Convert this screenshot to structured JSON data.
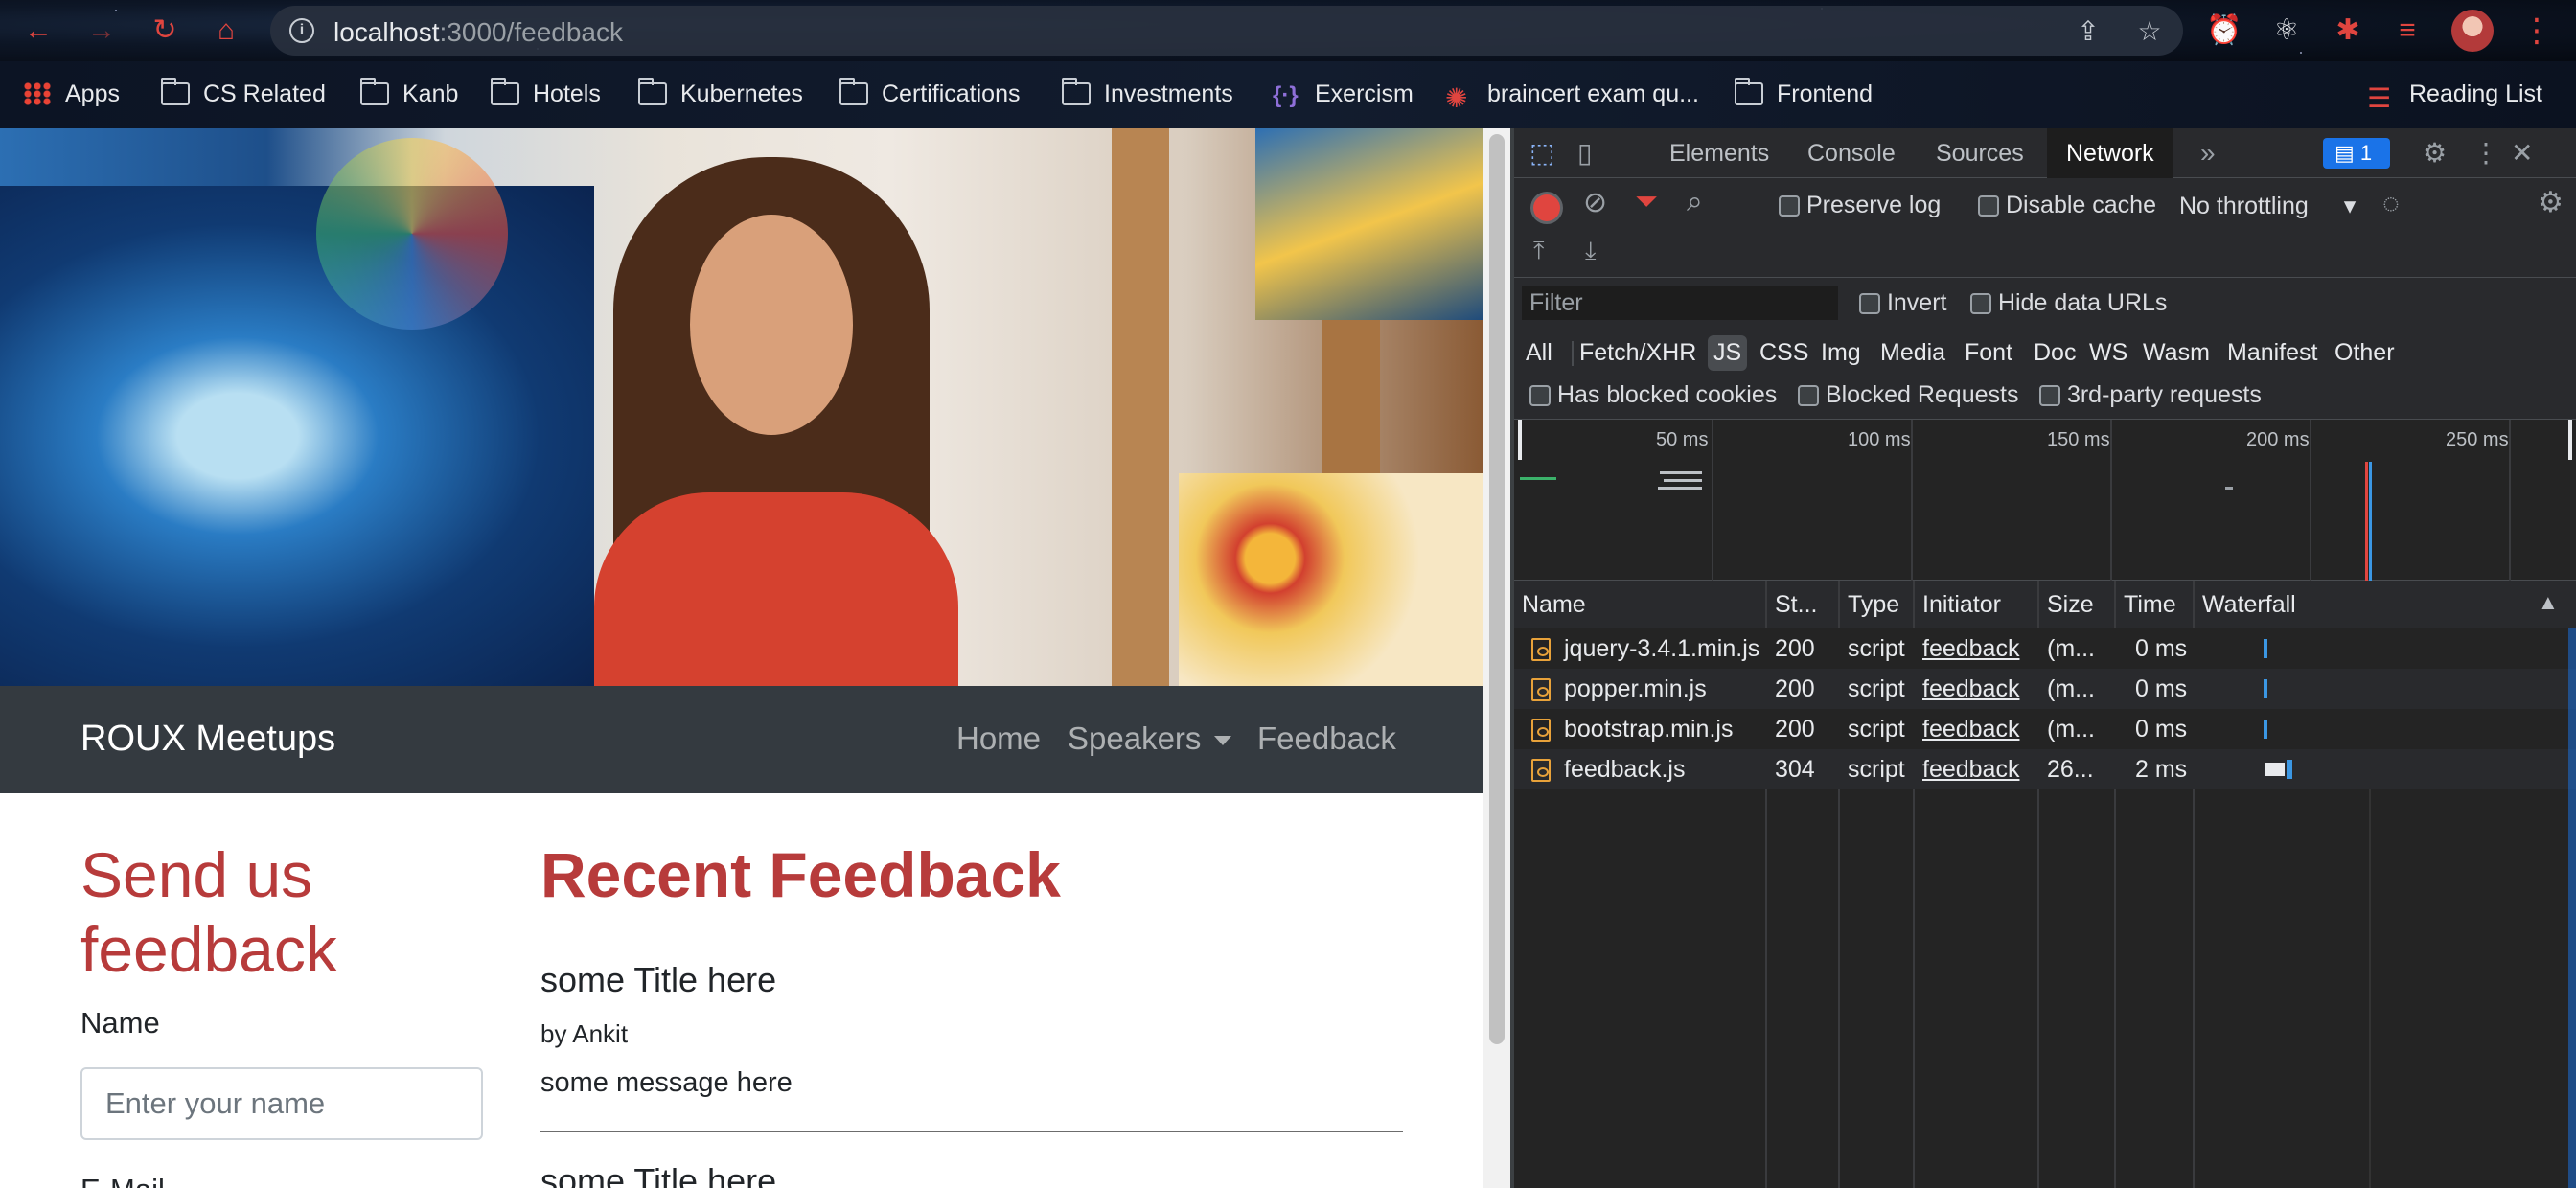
{
  "browser": {
    "url_host": "localhost",
    "url_path": ":3000/feedback",
    "bookmarks": [
      "Apps",
      "CS Related",
      "Kanb",
      "Hotels",
      "Kubernetes",
      "Certifications",
      "Investments",
      "Exercism",
      "braincert exam qu...",
      "Frontend"
    ],
    "reading_list": "Reading List"
  },
  "site": {
    "brand": "ROUX Meetups",
    "nav": {
      "home": "Home",
      "speakers": "Speakers",
      "feedback": "Feedback"
    },
    "send_title": "Send us feedback",
    "form": {
      "name_label": "Name",
      "name_placeholder": "Enter your name",
      "email_label": "E-Mail"
    },
    "recent_title": "Recent Feedback",
    "feedback_items": [
      {
        "title": "some Title here",
        "by": "by Ankit",
        "message": "some message here"
      },
      {
        "title": "some Title here"
      }
    ]
  },
  "devtools": {
    "tabs": [
      "Elements",
      "Console",
      "Sources",
      "Network"
    ],
    "active_tab": "Network",
    "issues_count": "1",
    "toolbar": {
      "preserve_log": "Preserve log",
      "disable_cache": "Disable cache",
      "throttling": "No throttling"
    },
    "filter": {
      "placeholder": "Filter",
      "invert": "Invert",
      "hide_data_urls": "Hide data URLs"
    },
    "types": [
      "All",
      "Fetch/XHR",
      "JS",
      "CSS",
      "Img",
      "Media",
      "Font",
      "Doc",
      "WS",
      "Wasm",
      "Manifest",
      "Other"
    ],
    "active_type": "JS",
    "extra_filters": {
      "blocked_cookies": "Has blocked cookies",
      "blocked_requests": "Blocked Requests",
      "third_party": "3rd-party requests"
    },
    "timeline_labels": [
      "50 ms",
      "100 ms",
      "150 ms",
      "200 ms",
      "250 ms"
    ],
    "columns": [
      "Name",
      "St...",
      "Type",
      "Initiator",
      "Size",
      "Time",
      "Waterfall"
    ],
    "rows": [
      {
        "name": "jquery-3.4.1.min.js",
        "status": "200",
        "type": "script",
        "initiator": "feedback",
        "size": "(m...",
        "time": "0 ms"
      },
      {
        "name": "popper.min.js",
        "status": "200",
        "type": "script",
        "initiator": "feedback",
        "size": "(m...",
        "time": "0 ms"
      },
      {
        "name": "bootstrap.min.js",
        "status": "200",
        "type": "script",
        "initiator": "feedback",
        "size": "(m...",
        "time": "0 ms"
      },
      {
        "name": "feedback.js",
        "status": "304",
        "type": "script",
        "initiator": "feedback",
        "size": "26...",
        "time": "2 ms"
      }
    ]
  },
  "colors": {
    "brand_red": "#b73b3b",
    "navbar": "#343a40",
    "devtools_bg": "#242424",
    "accent_blue": "#1a73e8"
  }
}
